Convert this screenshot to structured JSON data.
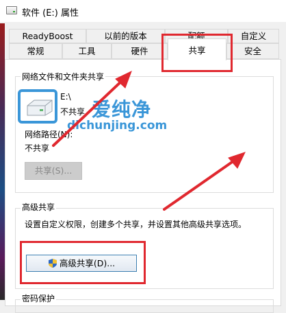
{
  "window": {
    "title": "软件 (E:) 属性"
  },
  "tabs_row1": [
    {
      "label": "ReadyBoost"
    },
    {
      "label": "以前的版本"
    },
    {
      "label": "配额"
    },
    {
      "label": "自定义"
    }
  ],
  "tabs_row2": [
    {
      "label": "常规"
    },
    {
      "label": "工具"
    },
    {
      "label": "硬件"
    },
    {
      "label": "共享",
      "active": true
    },
    {
      "label": "安全"
    }
  ],
  "network_sharing": {
    "group_title": "网络文件和文件夹共享",
    "drive_name": "E:\\",
    "drive_status": "不共享",
    "path_label": "网络路径(N):",
    "path_value": "不共享",
    "share_button": "共享(S)..."
  },
  "advanced_sharing": {
    "group_title": "高级共享",
    "description": "设置自定义权限，创建多个共享，并设置其他高级共享选项。",
    "button": "高级共享(D)..."
  },
  "password_protection": {
    "group_title": "密码保护"
  },
  "watermark": {
    "brand": "爱纯净",
    "url": "dichunjing.com"
  },
  "colors": {
    "annotation_red": "#e0282f",
    "watermark_blue": "#3a96d8",
    "button_border": "#3c7fb1"
  }
}
